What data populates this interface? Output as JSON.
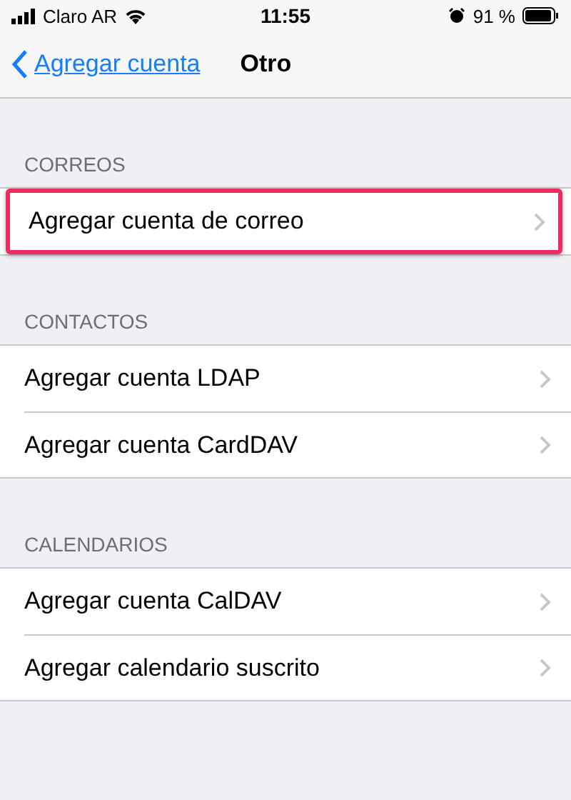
{
  "status_bar": {
    "carrier": "Claro AR",
    "time": "11:55",
    "battery": "91 %"
  },
  "nav": {
    "back": "Agregar cuenta",
    "title": "Otro"
  },
  "sections": [
    {
      "header": "CORREOS",
      "items": [
        {
          "label": "Agregar cuenta de correo",
          "highlighted": true
        }
      ]
    },
    {
      "header": "CONTACTOS",
      "items": [
        {
          "label": "Agregar cuenta LDAP",
          "highlighted": false
        },
        {
          "label": "Agregar cuenta CardDAV",
          "highlighted": false
        }
      ]
    },
    {
      "header": "CALENDARIOS",
      "items": [
        {
          "label": "Agregar cuenta CalDAV",
          "highlighted": false
        },
        {
          "label": "Agregar calendario suscrito",
          "highlighted": false
        }
      ]
    }
  ]
}
